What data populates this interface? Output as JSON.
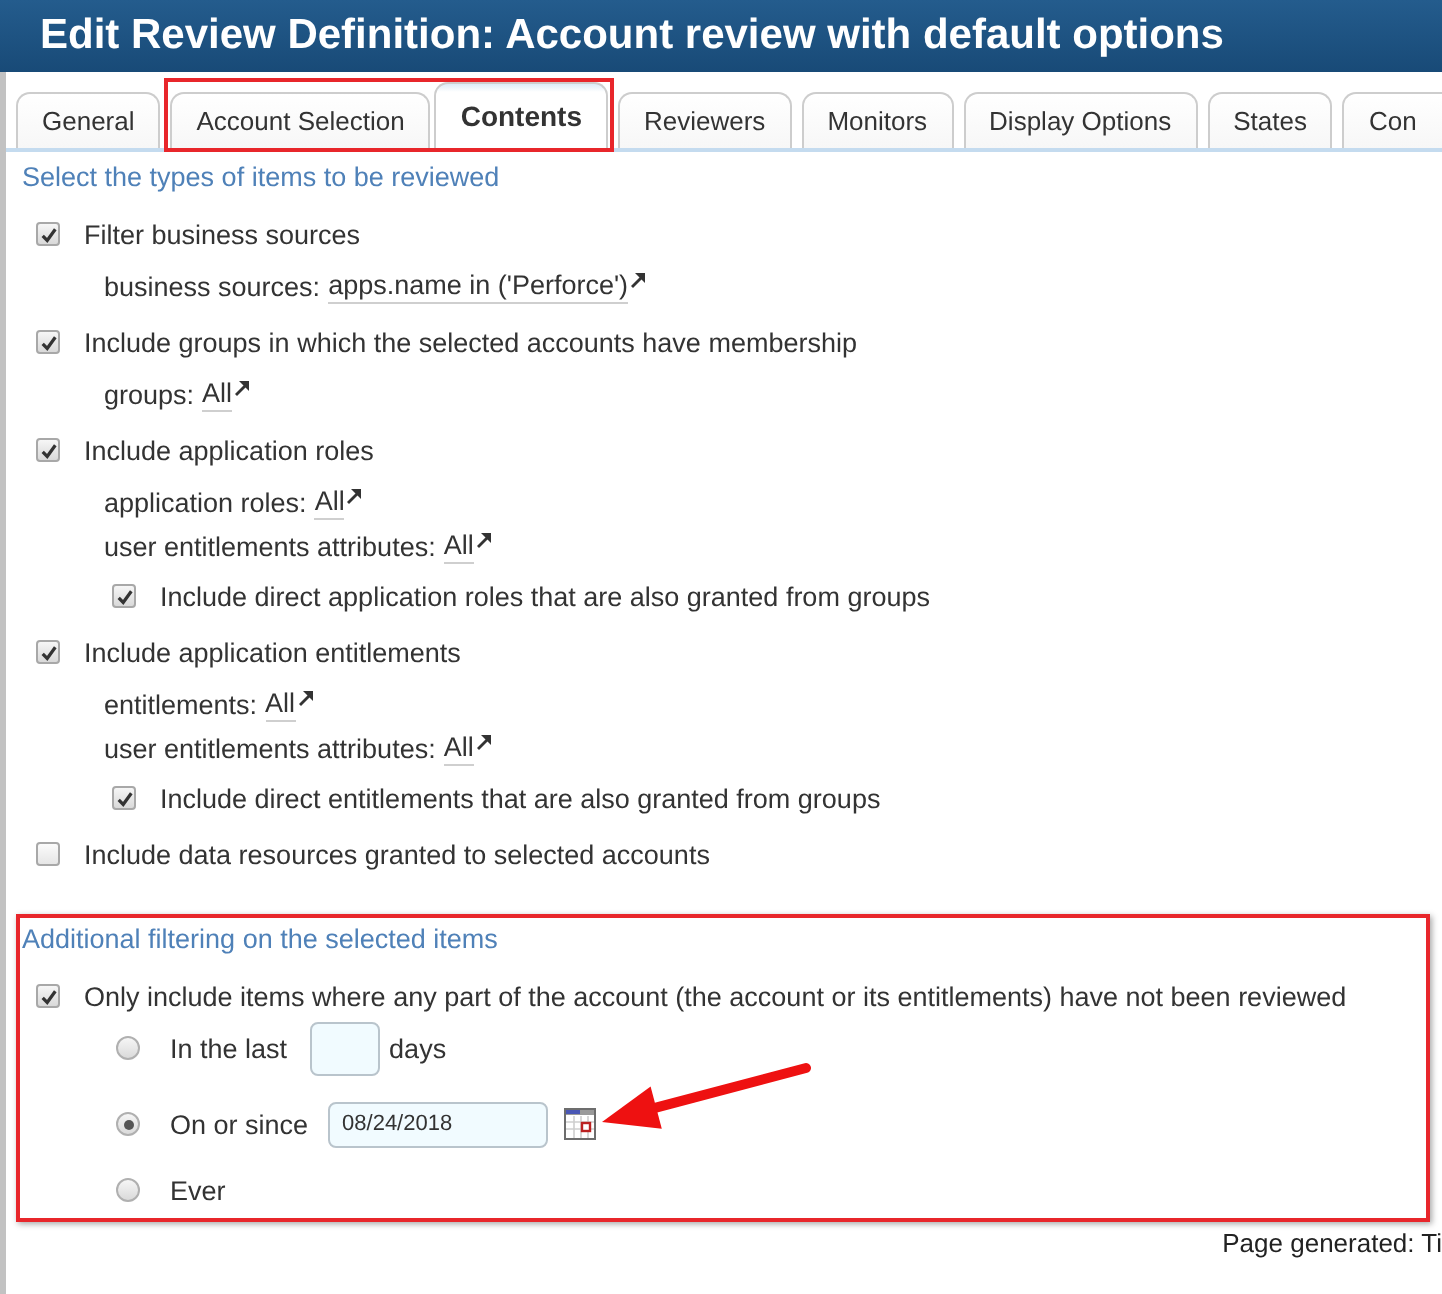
{
  "window": {
    "title": "Edit Review Definition: Account review with default options"
  },
  "tabs": [
    {
      "label": "General",
      "selected": false,
      "highlighted": false
    },
    {
      "label": "Account Selection",
      "selected": false,
      "highlighted": true
    },
    {
      "label": "Contents",
      "selected": true,
      "highlighted": true
    },
    {
      "label": "Reviewers",
      "selected": false,
      "highlighted": false
    },
    {
      "label": "Monitors",
      "selected": false,
      "highlighted": false
    },
    {
      "label": "Display Options",
      "selected": false,
      "highlighted": false
    },
    {
      "label": "States",
      "selected": false,
      "highlighted": false
    },
    {
      "label": "Con",
      "selected": false,
      "highlighted": false
    }
  ],
  "item_types": {
    "heading": "Select the types of items to be reviewed",
    "items": [
      {
        "label": "Filter business sources",
        "checked": true,
        "filters": [
          {
            "label": "business sources:",
            "value": "apps.name in ('Perforce')"
          }
        ]
      },
      {
        "label": "Include groups in which the selected accounts have membership",
        "checked": true,
        "filters": [
          {
            "label": "groups:",
            "value": "All"
          }
        ]
      },
      {
        "label": "Include application roles",
        "checked": true,
        "filters": [
          {
            "label": "application roles:",
            "value": "All"
          },
          {
            "label": "user entitlements attributes:",
            "value": "All"
          }
        ],
        "options": [
          {
            "label": "Include direct application roles that are also granted from groups",
            "checked": true
          }
        ]
      },
      {
        "label": "Include application entitlements",
        "checked": true,
        "filters": [
          {
            "label": "entitlements:",
            "value": "All"
          },
          {
            "label": "user entitlements attributes:",
            "value": "All"
          }
        ],
        "options": [
          {
            "label": "Include direct entitlements that are also granted from groups",
            "checked": true
          }
        ]
      },
      {
        "label": "Include data resources granted to selected accounts",
        "checked": false
      }
    ]
  },
  "additional_filtering": {
    "highlighted": true,
    "heading": "Additional filtering on the selected items",
    "option": {
      "label": "Only include items where any part of the account (the account or its entitlements) have not been reviewed",
      "checked": true
    },
    "choices": [
      {
        "kind": "days",
        "label": "In the last",
        "selected": false,
        "unit": "days"
      },
      {
        "kind": "date",
        "label": "On or since",
        "selected": true,
        "value": "08/24/2018"
      },
      {
        "kind": "plain",
        "label": "Ever",
        "selected": false
      }
    ]
  },
  "footer": {
    "text": "Page generated: Ti"
  }
}
